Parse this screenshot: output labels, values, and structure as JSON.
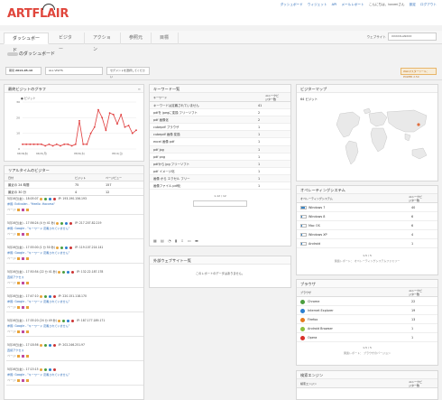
{
  "brand": {
    "art": "ART",
    "flair": "FLAIR"
  },
  "toplinks": [
    "ダッシュボード",
    "ウィジェット",
    "API",
    "メールレポート",
    "こんにちは、kanmiさん",
    "設定",
    "ログアウト"
  ],
  "tabs": [
    "ダッシュボード",
    "ビジター",
    "アクション",
    "参照元",
    "目標"
  ],
  "website": {
    "label": "ウェブサイト",
    "value": "XXXXXLANXXX"
  },
  "page_title": "のダッシュボード",
  "filters": {
    "date_label": "期間",
    "date": "2014-05-16",
    "site": "ALL VISITS",
    "segment": "セグメントを選択してください"
  },
  "upgrade_button": "Webマスターツール：POWER 2.50",
  "visits_graph": {
    "title": "最終ビジットのグラフ",
    "legend": "ビジット"
  },
  "chart_data": {
    "type": "line",
    "x": [
      "04/16(水)",
      "04/21(月)",
      "04/26(土)",
      "05/01(木)",
      "05/06(火)",
      "05/11(日)",
      "05/16(金)"
    ],
    "values": [
      3,
      3,
      3,
      3,
      3,
      3,
      2,
      3,
      2,
      3,
      2,
      3,
      3,
      2,
      3,
      18,
      3,
      3,
      10,
      14,
      25,
      20,
      12,
      23,
      22,
      16,
      22,
      14,
      15,
      10,
      12
    ],
    "y_ticks": [
      "30",
      "20",
      "10",
      "0"
    ],
    "ylim": [
      0,
      30
    ],
    "color": "#e03c3c"
  },
  "realtime": {
    "title": "リアルタイムのビジター",
    "cols": [
      "日付",
      "ビジット",
      "ページビュー"
    ],
    "rows": [
      {
        "label": "最近の 24 時間",
        "visits": "75",
        "pv": "157"
      },
      {
        "label": "最近の 30 分",
        "visits": "4",
        "pv": "12"
      }
    ],
    "visitors": [
      {
        "time": "5月16日(金) - 18:05:07",
        "ip": "IP: 193.190.156.193",
        "ref": "参照: Extivalen - \"Heello .Haccess\"",
        "pages": "ページ:"
      },
      {
        "time": "5月16日(金) - 17:56:24 (4 分 41 秒)",
        "ip": "IP: 217.207.82.219",
        "ref": "参照: Google - \"キーワード 定義されていません\"",
        "pages": "ページ:"
      },
      {
        "time": "5月16日(金) - 17:55:00 (1 分 50 秒)",
        "ip": "IP: 119.107.214.141",
        "ref": "参照: Google - \"キーワード 定義されていません\"",
        "pages": "ページ:"
      },
      {
        "time": "5月16日(金) - 17:50:54 (22 分 41 秒)",
        "ip": "IP: 132.22.187.178",
        "ref": "直接アクセス",
        "pages": "ページ:"
      },
      {
        "time": "5月16日(金) - 17:47:10",
        "ip": "IP: 220.151.118.170",
        "ref": "参照: Google - \"キーワード 定義されていません\"",
        "pages": "ページ:"
      },
      {
        "time": "5月16日(金) - 17:35:20 (24 分 49 秒)",
        "ip": "IP: 187.177.189.171",
        "ref": "参照: Google - \"キーワード 定義されていません\"",
        "pages": "ページ:"
      },
      {
        "time": "5月16日(金) - 17:18:56",
        "ip": "IP: 202.246.251.97",
        "ref": "直接アクセス",
        "pages": "ページ:"
      },
      {
        "time": "5月16日(金) - 17:15:15",
        "ip": "",
        "ref": "参照: Google - \"キーワード 定義されていません\"",
        "pages": "ページ:"
      }
    ]
  },
  "keywords": {
    "title": "キーワード一覧",
    "head_left": "キーワード",
    "head_right": "ユニークビジター数",
    "rows": [
      {
        "k": "キーワードは定義されていません",
        "v": "41"
      },
      {
        "k": "pdfを jpegに変換 フリーソフト",
        "v": "2"
      },
      {
        "k": "pdf 画像化",
        "v": "2"
      },
      {
        "k": "cubepdf ブラウザ",
        "v": "1"
      },
      {
        "k": "cubepdf 画像 変換",
        "v": "1"
      },
      {
        "k": "excel 画像 pdf",
        "v": "1"
      },
      {
        "k": "pdf jpg",
        "v": "1"
      },
      {
        "k": "pdf png",
        "v": "1"
      },
      {
        "k": "pdfから jpg フリーソフト",
        "v": "1"
      },
      {
        "k": "pdf イメージ化",
        "v": "1"
      },
      {
        "k": "画像 から エクセル フリー",
        "v": "1"
      },
      {
        "k": "画像ファイル pdf化",
        "v": "1"
      }
    ],
    "pager": "1-12 / 12"
  },
  "outlinks": {
    "title": "外部ウェブサイト一覧",
    "empty": "このレポートのデータはありません。"
  },
  "map": {
    "title": "ビジターマップ",
    "label": "64 ビジット"
  },
  "os": {
    "title": "オペレーティングシステム",
    "head_left": "オペレーティングシステム",
    "head_right": "ユニークビジター数",
    "rows": [
      {
        "k": "Windows 7",
        "v": "40",
        "p": 0.8
      },
      {
        "k": "Windows 8",
        "v": "6",
        "p": 0.15
      },
      {
        "k": "Mac OS",
        "v": "6",
        "p": 0.15
      },
      {
        "k": "Windows XP",
        "v": "4",
        "p": 0.1
      },
      {
        "k": "Android",
        "v": "1",
        "p": 0.05
      }
    ],
    "pager": "1-5 / 5",
    "link": "関連レポート： オペレーティングシステムファミリー"
  },
  "browser": {
    "title": "ブラウザ",
    "head_left": "ブラウザ",
    "head_right": "ユニークビジター数",
    "rows": [
      {
        "k": "Chrome",
        "v": "22",
        "c": "#4a9e3f"
      },
      {
        "k": "Internet Explorer",
        "v": "19",
        "c": "#2a7fd0"
      },
      {
        "k": "Firefox",
        "v": "13",
        "c": "#e57a1e"
      },
      {
        "k": "Android Browser",
        "v": "1",
        "c": "#8bbf3d"
      },
      {
        "k": "Opera",
        "v": "1",
        "c": "#d8302a"
      }
    ],
    "pager": "1-5 / 5",
    "link": "関連レポート： ブラウザのバージョン"
  },
  "search": {
    "title": "検索エンジン",
    "head_left": "検索エンジン",
    "head_right": "ユニークビジター数"
  }
}
